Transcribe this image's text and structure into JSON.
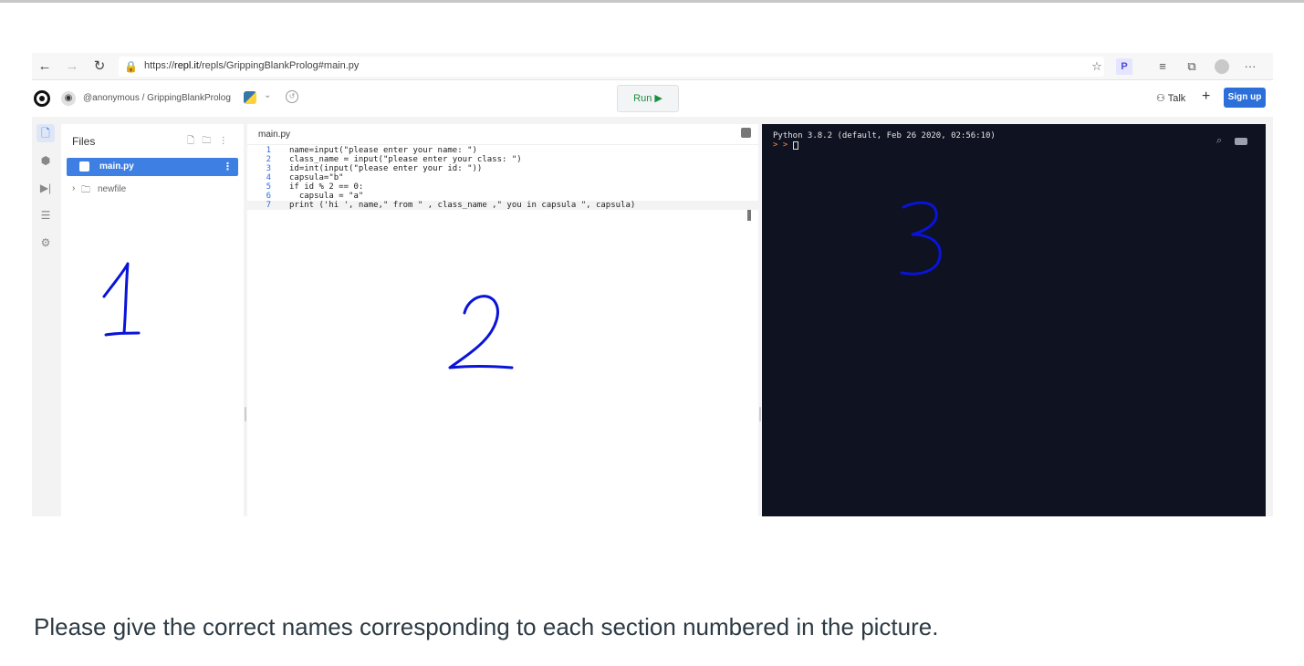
{
  "browser": {
    "url_prefix": "https://",
    "url_host": "repl.it",
    "url_path": "/repls/GrippingBlankProlog#main.py",
    "profile_badge": "P",
    "menu": "···"
  },
  "repl_header": {
    "path": "@anonymous / GrippingBlankProlog",
    "run_label": "Run ▶",
    "talk_label": "Talk",
    "plus_label": "+",
    "signup_label": "Sign up"
  },
  "files_panel": {
    "title": "Files",
    "files": [
      {
        "name": "main.py",
        "active": true
      },
      {
        "name": "newfile",
        "active": false
      }
    ]
  },
  "editor": {
    "tab_label": "main.py",
    "lines": [
      {
        "num": "1",
        "text": "name=input(\"please enter your name: \")"
      },
      {
        "num": "2",
        "text": "class_name = input(\"please enter your class: \")"
      },
      {
        "num": "3",
        "text": "id=int(input(\"please enter your id: \"))"
      },
      {
        "num": "4",
        "text": "capsula=\"b\""
      },
      {
        "num": "5",
        "text": "if id % 2 == 0:"
      },
      {
        "num": "6",
        "text": "  capsula = \"a\""
      },
      {
        "num": "7",
        "text": "print ('hi ', name,\" from \" , class_name ,\" you in capsula \", capsula)"
      }
    ]
  },
  "console": {
    "banner": "Python 3.8.2 (default, Feb 26 2020, 02:56:10)",
    "prompt": "> >"
  },
  "annotations": {
    "one": "1",
    "two": "2",
    "three": "3",
    "color": "#0a14d8"
  },
  "question": "Please give the correct names corresponding to each section numbered in the picture."
}
